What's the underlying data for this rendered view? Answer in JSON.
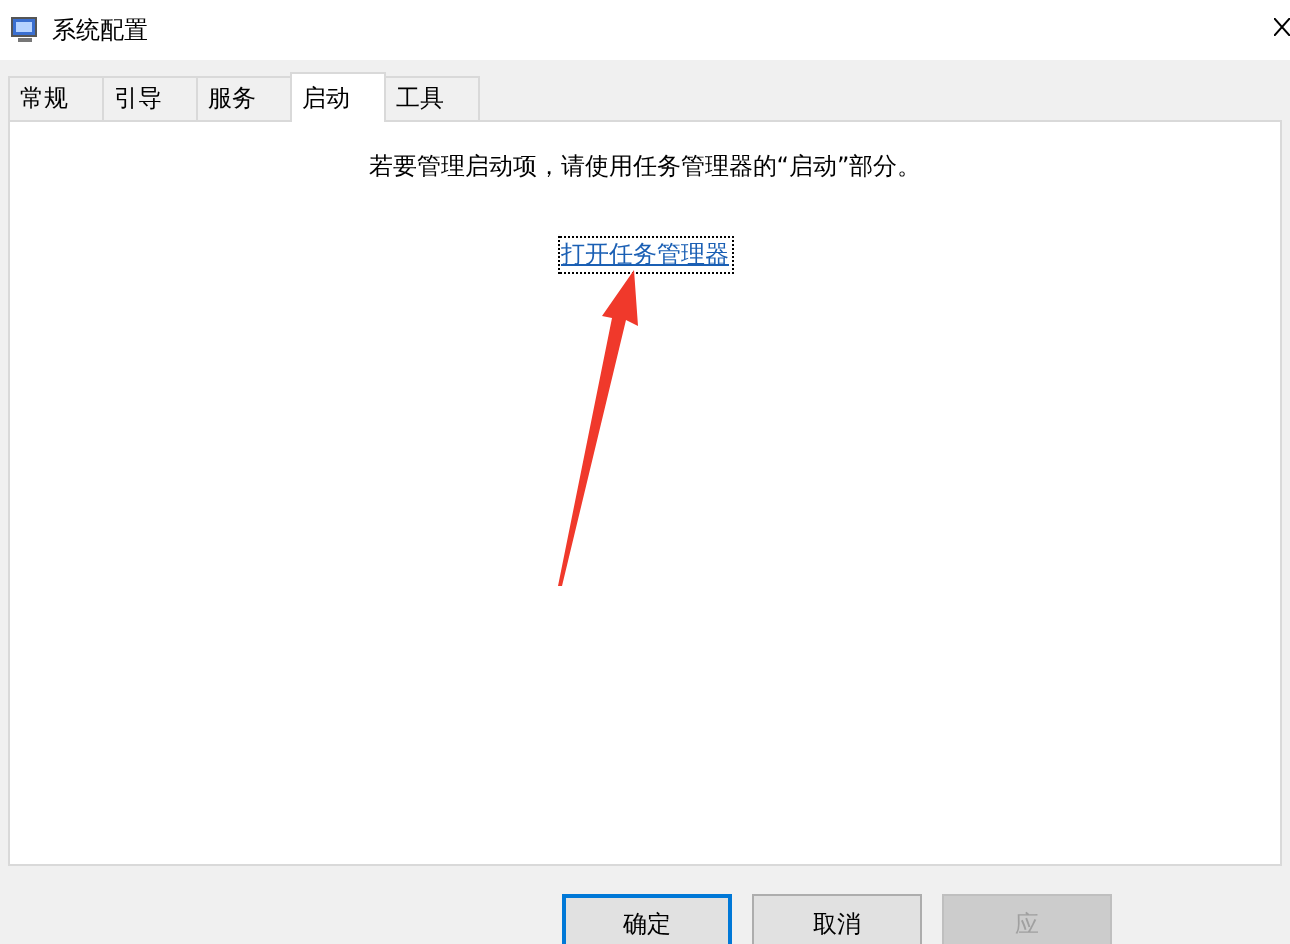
{
  "window": {
    "title": "系统配置"
  },
  "tabs": [
    {
      "label": "常规",
      "selected": false
    },
    {
      "label": "引导",
      "selected": false
    },
    {
      "label": "服务",
      "selected": false
    },
    {
      "label": "启动",
      "selected": true
    },
    {
      "label": "工具",
      "selected": false
    }
  ],
  "panel": {
    "message": "若要管理启动项，请使用任务管理器的“启动”部分。",
    "link": "打开任务管理器"
  },
  "buttons": [
    {
      "label": "确定",
      "default": true,
      "disabled": false
    },
    {
      "label": "取消",
      "default": false,
      "disabled": false
    },
    {
      "label": "应",
      "default": false,
      "disabled": true
    }
  ]
}
